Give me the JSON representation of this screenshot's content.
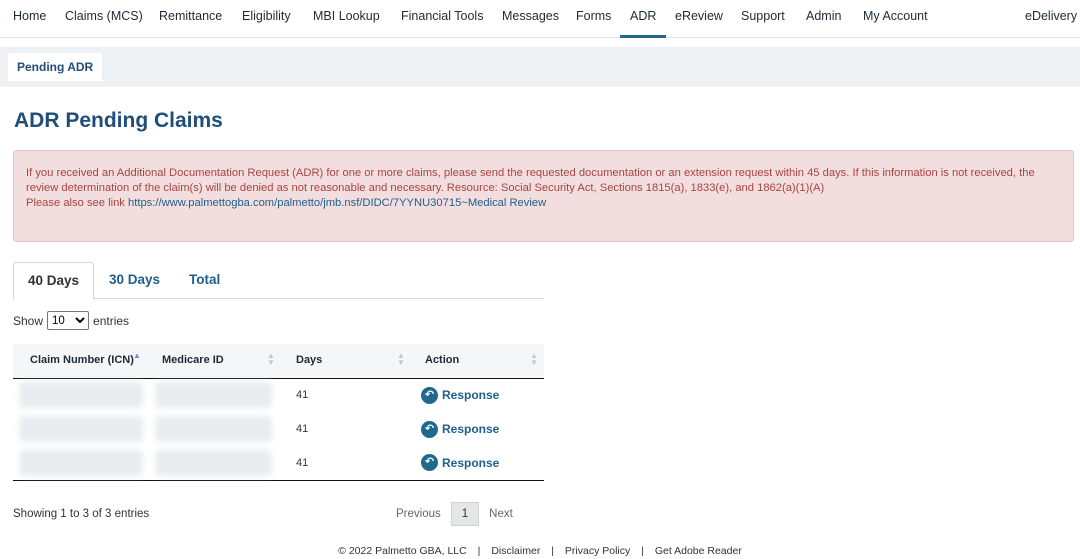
{
  "nav": {
    "items": [
      "Home",
      "Claims (MCS)",
      "Remittance",
      "Eligibility",
      "MBI Lookup",
      "Financial Tools",
      "Messages",
      "Forms",
      "ADR",
      "eReview",
      "Support",
      "Admin",
      "My Account"
    ],
    "right_item": "eDelivery",
    "active": "ADR"
  },
  "subnav": {
    "tab": "Pending ADR"
  },
  "page": {
    "title": "ADR Pending Claims"
  },
  "alert": {
    "line1": "If you received an Additional Documentation Request (ADR) for one or more claims, please send the requested documentation or an extension request within 45 days. If this information is not received, the review determination of the claim(s) will be denied as not reasonable and necessary. Resource: Social Security Act, Sections 1815(a), 1833(e), and 1862(a)(1)(A)",
    "line2_prefix": "Please also see link ",
    "link": "https://www.palmettogba.com/palmetto/jmb.nsf/DIDC/7YYNU30715~Medical Review"
  },
  "tabs": [
    "40 Days",
    "30 Days",
    "Total"
  ],
  "length": {
    "label_show": "Show",
    "value": "10",
    "options": [
      "10"
    ],
    "label_entries": "entries"
  },
  "table": {
    "columns": [
      "Claim Number (ICN)",
      "Medicare ID",
      "Days",
      "Action"
    ],
    "rows": [
      {
        "days": "41",
        "action": "Response"
      },
      {
        "days": "41",
        "action": "Response"
      },
      {
        "days": "41",
        "action": "Response"
      }
    ]
  },
  "info": "Showing 1 to 3 of 3 entries",
  "pager": {
    "previous": "Previous",
    "current": "1",
    "next": "Next"
  },
  "footer": {
    "copyright": "© 2022 Palmetto GBA, LLC",
    "links": [
      "Disclaimer",
      "Privacy Policy",
      "Get Adobe Reader"
    ],
    "separator": "|"
  },
  "colors": {
    "accent": "#1f6a8c",
    "title": "#1f4e79",
    "alert_bg": "#f2dede",
    "alert_text": "#a94442"
  }
}
